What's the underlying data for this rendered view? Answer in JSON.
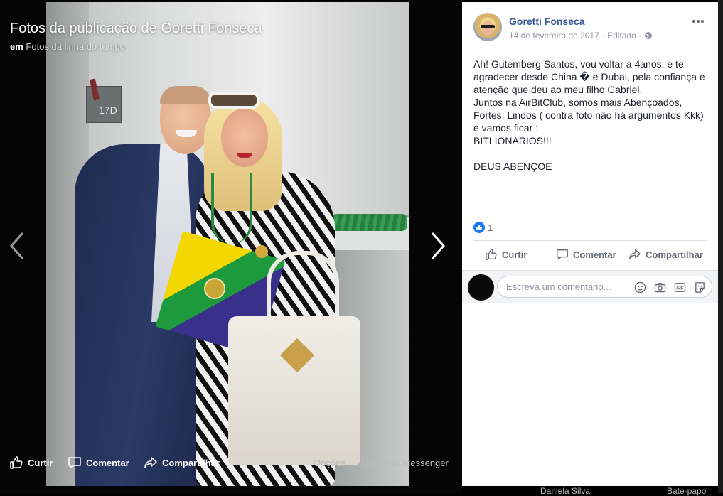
{
  "viewer": {
    "title": "Fotos da publicação de Goretti Fonseca",
    "subtitle_prefix": "em",
    "subtitle_link": "Fotos da linha do tempo",
    "photo_sign": "17D",
    "actions": {
      "like": "Curtir",
      "comment": "Comentar",
      "share": "Compartilhar",
      "options": "Opções",
      "messenger": "Enviar no Messenger"
    },
    "nav_icons": [
      "chevron-left-icon",
      "chevron-right-icon"
    ]
  },
  "post": {
    "author": "Goretti Fonseca",
    "date": "14 de fevereiro de 2017",
    "edited": "· Editado ·",
    "privacy_icon": "globe-icon",
    "text_lines": [
      "Ah! Gutemberg Santos, vou voltar a 4anos, e te agradecer desde China � e Dubai, pela confiança e atenção que deu ao meu filho Gabriel.",
      "Juntos na AirBitClub, somos mais Abençoados, Fortes, Lindos ( contra foto não há argumentos Kkk) e vamos ficar :",
      "BITLIONARIOS!!!"
    ],
    "closing": "DEUS ABENÇOE",
    "reaction_count": "1",
    "actions": {
      "like": "Curtir",
      "comment": "Comentar",
      "share": "Compartilhar"
    },
    "comment_placeholder": "Escreva um comentário...",
    "comment_icons": [
      "emoji-icon",
      "camera-icon",
      "gif-icon",
      "sticker-icon"
    ]
  },
  "background_peek": {
    "left": "Daniela Silva",
    "right": "Bate-papo"
  },
  "colors": {
    "link_blue": "#385898",
    "like_blue": "#1877f2",
    "viewer_bg": "#000000",
    "panel_bg": "#ffffff"
  }
}
